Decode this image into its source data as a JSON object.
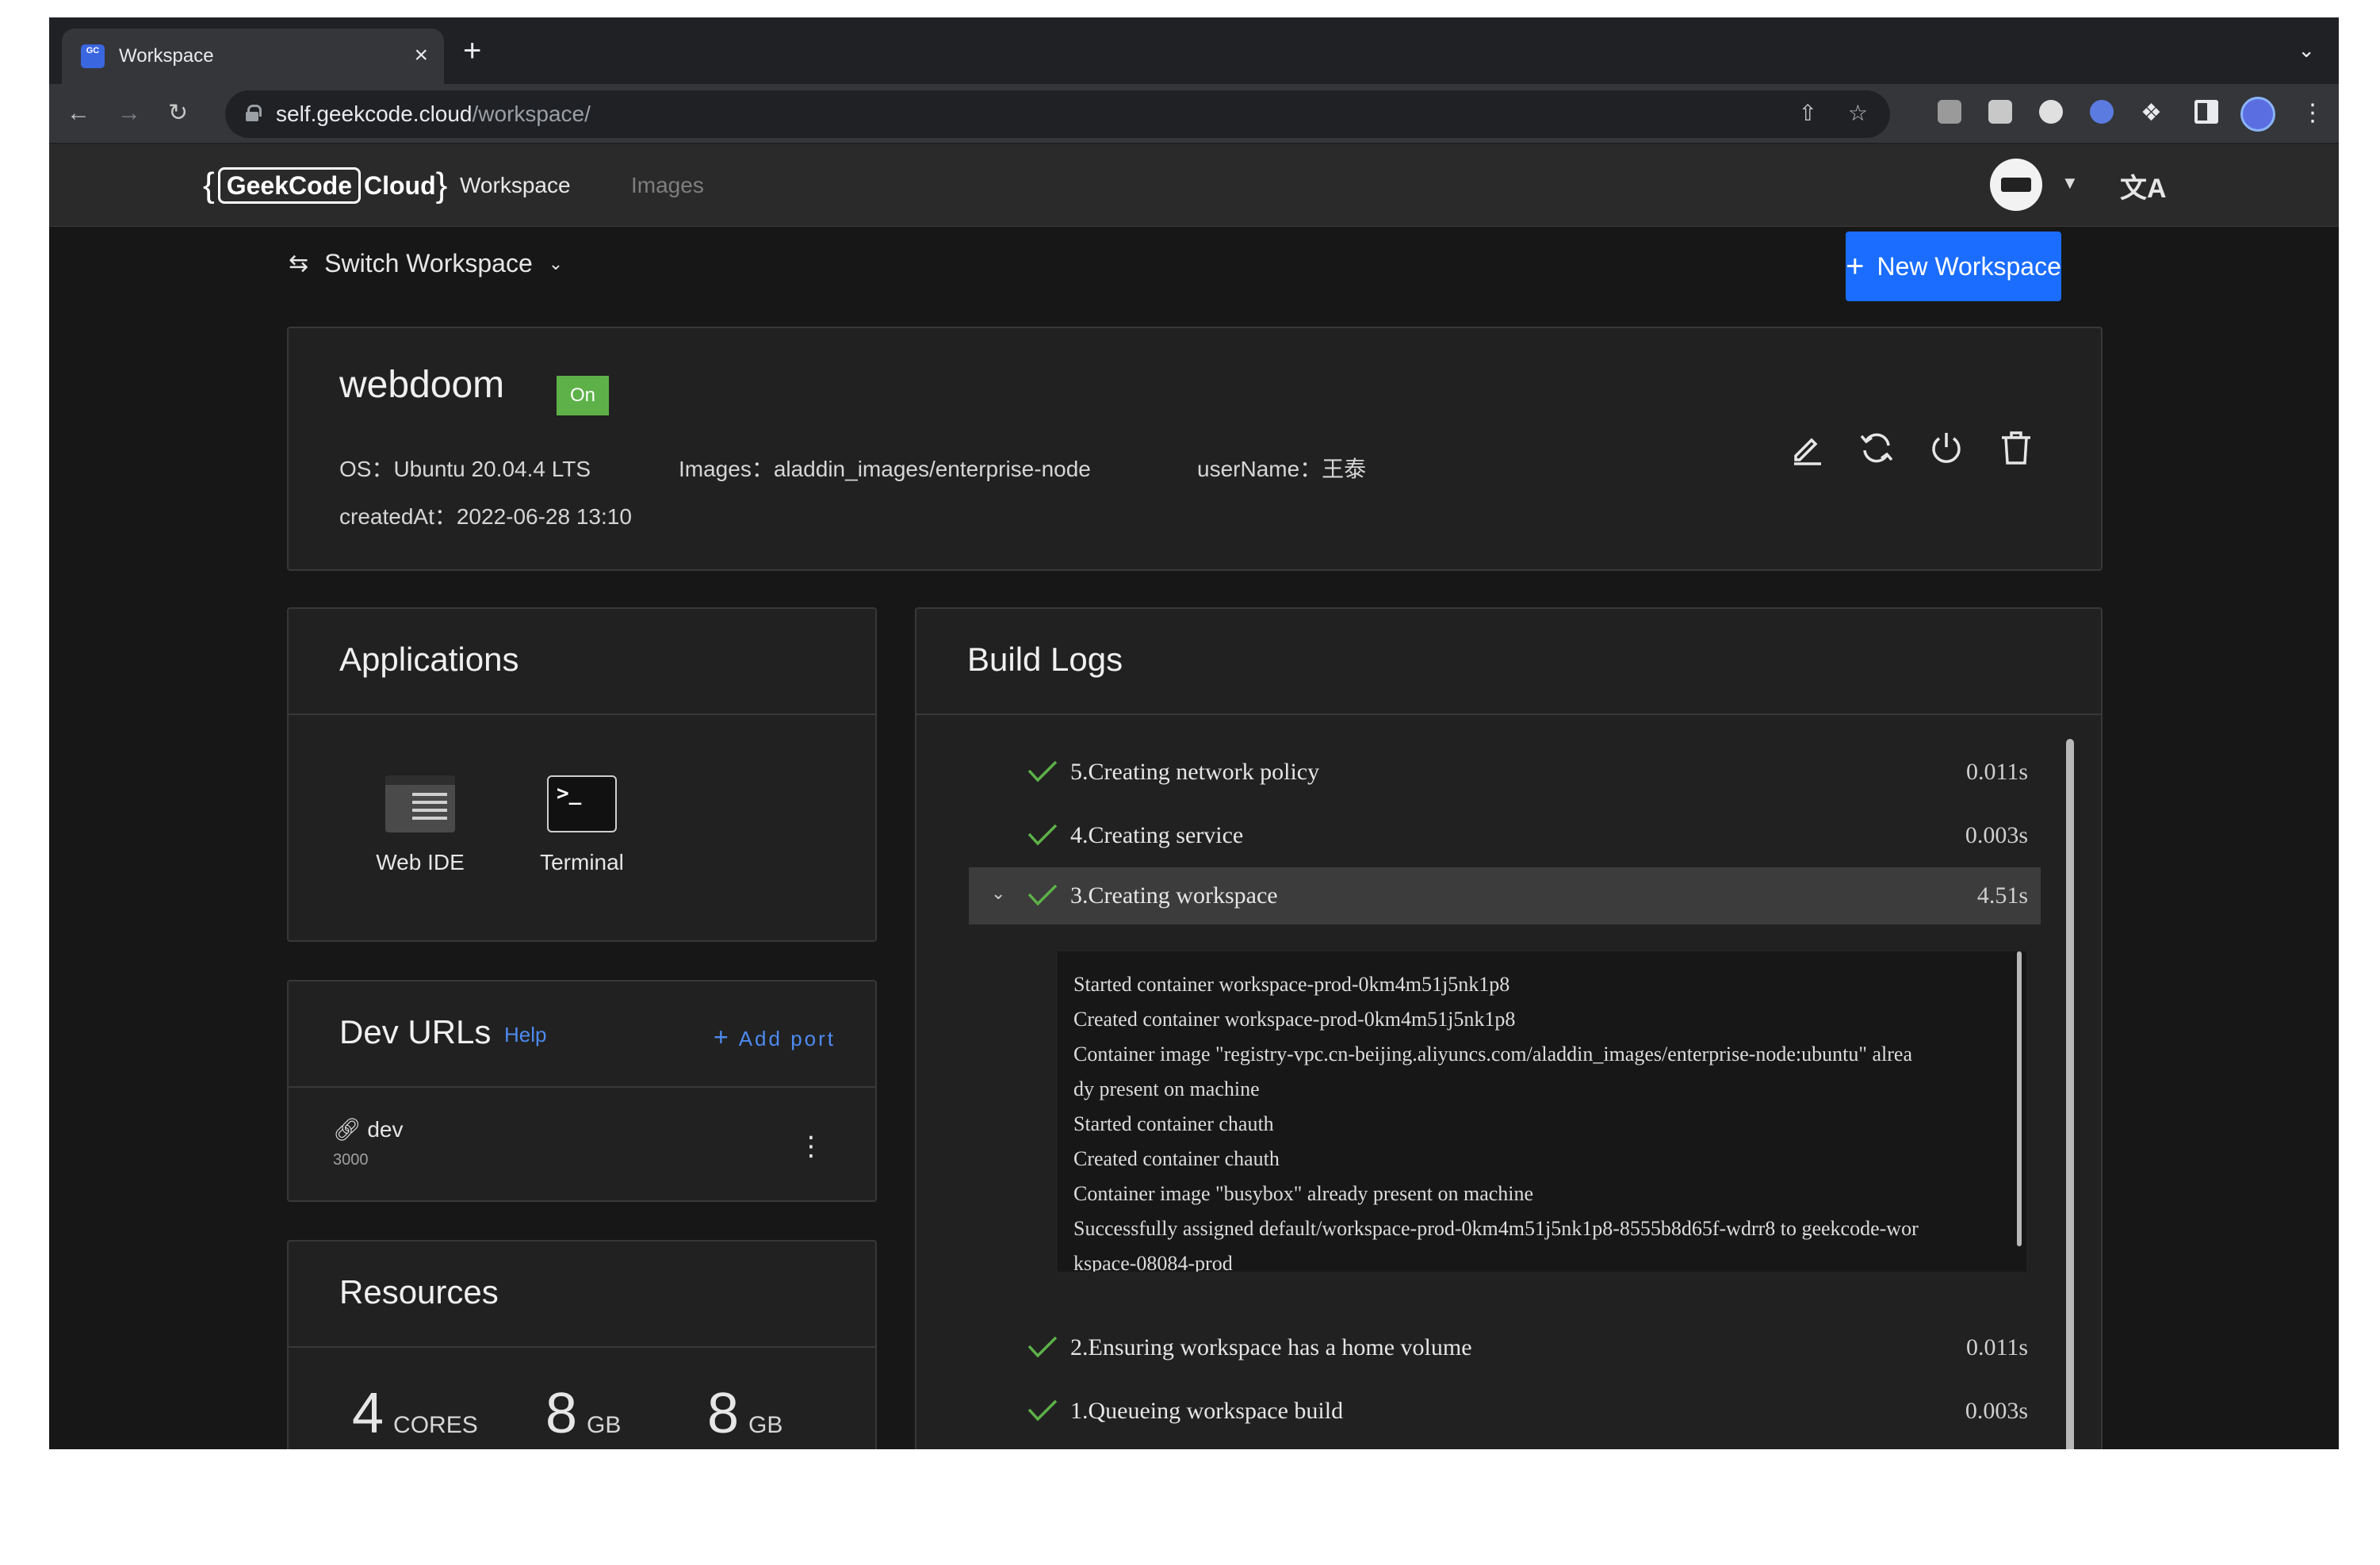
{
  "browser": {
    "tab_title": "Workspace",
    "favicon_text": "GC",
    "close_glyph": "×",
    "newtab_glyph": "+",
    "url_host": "self.geekcode.cloud",
    "url_path": "/workspace/"
  },
  "header": {
    "logo_left": "GeekCode",
    "logo_right": "Cloud",
    "nav": [
      {
        "label": "Workspace",
        "active": true
      },
      {
        "label": "Images",
        "active": false
      }
    ],
    "lang_glyph": "文A"
  },
  "toolbar": {
    "switch_label": "Switch Workspace",
    "new_label": "New Workspace"
  },
  "workspace": {
    "name": "webdoom",
    "status": "On",
    "os": "OS：Ubuntu 20.04.4 LTS",
    "images": "Images：aladdin_images/enterprise-node",
    "username": "userName：王泰",
    "created": "createdAt：2022-06-28 13:10",
    "actions": [
      "edit-icon",
      "refresh-icon",
      "power-icon",
      "trash-icon"
    ]
  },
  "applications": {
    "title": "Applications",
    "items": [
      {
        "label": "Web IDE",
        "icon": "web-ide-icon"
      },
      {
        "label": "Terminal",
        "icon": "terminal-icon",
        "glyph": ">_"
      }
    ]
  },
  "devurls": {
    "title": "Dev URLs",
    "help": "Help",
    "add_port": "Add port",
    "rows": [
      {
        "name": "dev",
        "port": "3000"
      }
    ]
  },
  "resources": {
    "title": "Resources",
    "items": [
      {
        "value": "4",
        "unit": "CORES"
      },
      {
        "value": "8",
        "unit": "GB"
      },
      {
        "value": "8",
        "unit": "GB"
      }
    ]
  },
  "build_logs": {
    "title": "Build Logs",
    "steps": [
      {
        "label": "5.Creating network policy",
        "time": "0.011s"
      },
      {
        "label": "4.Creating service",
        "time": "0.003s"
      },
      {
        "label": "3.Creating workspace",
        "time": "4.51s",
        "expanded": true
      },
      {
        "label": "2.Ensuring workspace has a home volume",
        "time": "0.011s"
      },
      {
        "label": "1.Queueing workspace build",
        "time": "0.003s"
      }
    ],
    "log_lines": [
      "Started container workspace-prod-0km4m51j5nk1p8",
      "Created container workspace-prod-0km4m51j5nk1p8",
      "Container image \"registry-vpc.cn-beijing.aliyuncs.com/aladdin_images/enterprise-node:ubuntu\" alrea",
      "dy present on machine",
      "Started container chauth",
      "Created container chauth",
      "Container image \"busybox\" already present on machine",
      "Successfully assigned default/workspace-prod-0km4m51j5nk1p8-8555b8d65f-wdrr8 to geekcode-wor",
      "kspace-08084-prod"
    ]
  },
  "colors": {
    "accent": "#1a6dff",
    "status_on": "#5db148",
    "check": "#5db148",
    "link": "#4d8af0"
  }
}
